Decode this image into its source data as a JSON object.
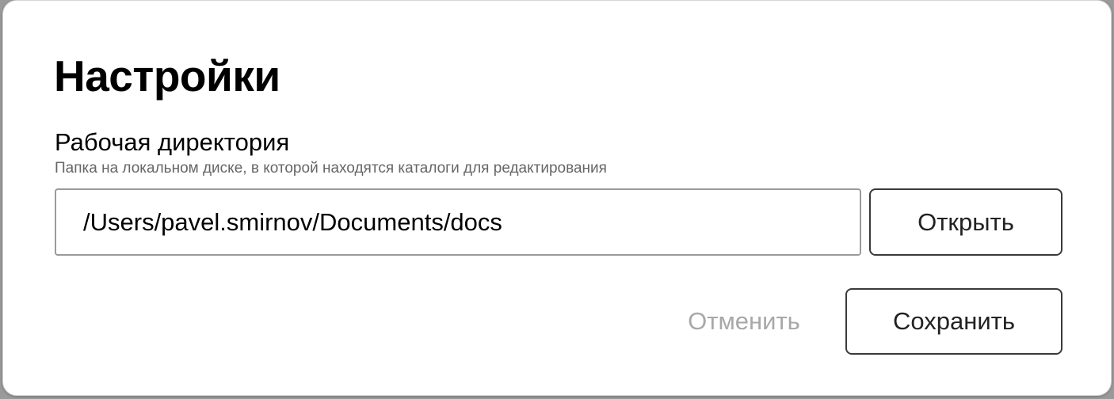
{
  "dialog": {
    "title": "Настройки",
    "working_dir": {
      "label": "Рабочая директория",
      "hint": "Папка на локальном диске, в которой находятся каталоги для редактирования",
      "value": "/Users/pavel.smirnov/Documents/docs"
    },
    "open_label": "Открыть",
    "cancel_label": "Отменить",
    "save_label": "Сохранить"
  },
  "colors": {
    "background": "#ffffff",
    "text": "#000000",
    "hint": "#666666",
    "input_border": "#9a9a9a",
    "button_border": "#3a3a3a",
    "disabled_text": "#a8a8a8"
  }
}
